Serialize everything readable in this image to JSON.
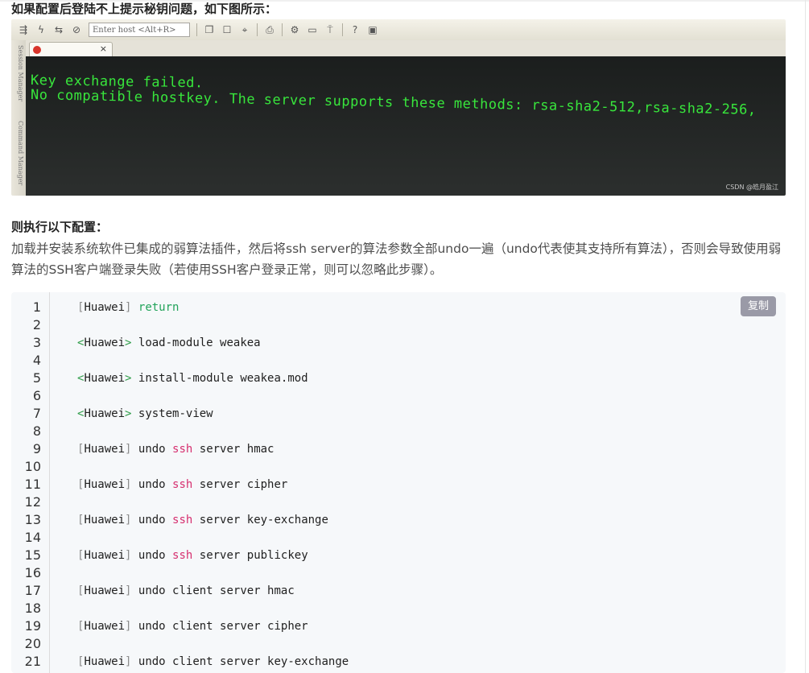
{
  "article": {
    "intro_heading": "如果配置后登陆不上提示秘钥问题，如下图所示：",
    "config_heading": "则执行以下配置：",
    "paragraph": "加载并安装系统软件已集成的弱算法插件，然后将ssh server的算法参数全部undo一遍（undo代表使其支持所有算法），否则会导致使用弱算法的SSH客户端登录失败（若使用SSH客户登录正常，则可以忽略此步骤）。"
  },
  "screenshot": {
    "host_placeholder": "Enter host <Alt+R>",
    "sidebar_labels": [
      "Session Manager",
      "Command Manager"
    ],
    "terminal_lines": [
      "Key exchange failed.",
      "No compatible hostkey. The server supports these methods: rsa-sha2-512,rsa-sha2-256,"
    ],
    "watermark": "CSDN @皓月盈江",
    "tab_close": "×",
    "toolbar_icons": [
      "connect-icon",
      "lightning-icon",
      "reconnect-icon",
      "disconnect-icon",
      "copy-icon",
      "paste-icon",
      "find-icon",
      "print-icon",
      "settings-icon",
      "keymap-icon",
      "sftp-icon",
      "help-icon",
      "about-icon"
    ]
  },
  "code_block": {
    "copy_label": "复制",
    "lines": [
      {
        "n": "1",
        "br": "[",
        "host": "Huawei",
        "br2": "]",
        "kw": "return",
        "kw_color": "green",
        "rest": ""
      },
      {
        "n": "2"
      },
      {
        "n": "3",
        "br": "<",
        "host": "Huawei",
        "br2": ">",
        "kw": "",
        "rest": "load-module weakea"
      },
      {
        "n": "4"
      },
      {
        "n": "5",
        "br": "<",
        "host": "Huawei",
        "br2": ">",
        "kw": "",
        "rest": "install-module weakea.mod"
      },
      {
        "n": "6"
      },
      {
        "n": "7",
        "br": "<",
        "host": "Huawei",
        "br2": ">",
        "kw": "",
        "rest": "system-view"
      },
      {
        "n": "8"
      },
      {
        "n": "9",
        "br": "[",
        "host": "Huawei",
        "br2": "]",
        "pre": "undo ",
        "kw": "ssh",
        "kw_color": "red",
        "rest": " server hmac"
      },
      {
        "n": "10"
      },
      {
        "n": "11",
        "br": "[",
        "host": "Huawei",
        "br2": "]",
        "pre": "undo ",
        "kw": "ssh",
        "kw_color": "red",
        "rest": " server cipher"
      },
      {
        "n": "12"
      },
      {
        "n": "13",
        "br": "[",
        "host": "Huawei",
        "br2": "]",
        "pre": "undo ",
        "kw": "ssh",
        "kw_color": "red",
        "rest": " server key-exchange"
      },
      {
        "n": "14"
      },
      {
        "n": "15",
        "br": "[",
        "host": "Huawei",
        "br2": "]",
        "pre": "undo ",
        "kw": "ssh",
        "kw_color": "red",
        "rest": " server publickey"
      },
      {
        "n": "16"
      },
      {
        "n": "17",
        "br": "[",
        "host": "Huawei",
        "br2": "]",
        "kw": "",
        "rest": "undo client server hmac"
      },
      {
        "n": "18"
      },
      {
        "n": "19",
        "br": "[",
        "host": "Huawei",
        "br2": "]",
        "kw": "",
        "rest": "undo client server cipher"
      },
      {
        "n": "20"
      },
      {
        "n": "21",
        "br": "[",
        "host": "Huawei",
        "br2": "]",
        "kw": "",
        "rest": "undo client server key-exchange"
      }
    ]
  },
  "colors": {
    "terminal_green": "#38e63c",
    "keyword_green": "#22a35a",
    "keyword_red": "#d62f6f",
    "copy_button": "#9a9aa7"
  }
}
